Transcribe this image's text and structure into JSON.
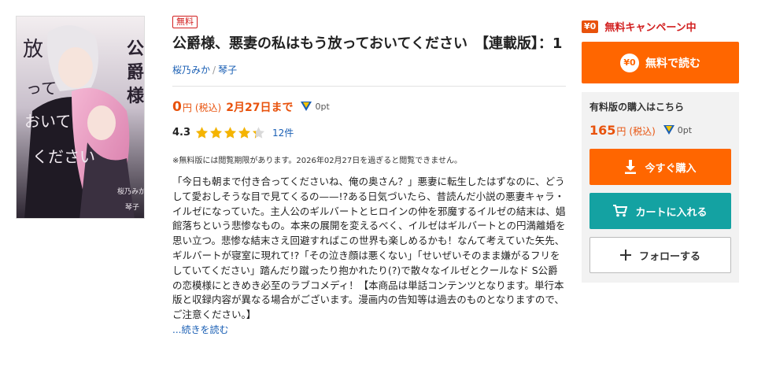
{
  "book": {
    "cover_alt": "公爵様、悪妻の私はもう放っておいてください 表紙",
    "free_badge": "無料",
    "title": "公爵様、悪妻の私はもう放っておいてください　【連載版】：1",
    "authors": [
      "桜乃みか",
      "琴子"
    ],
    "author_separator": "/",
    "price": {
      "amount": "0",
      "unit": "円",
      "tax": "(税込)",
      "deadline": "2月27日まで",
      "points": "0pt"
    },
    "rating": {
      "score": "4.3",
      "stars_value": 4.3,
      "stars_max": 5,
      "review_count": "12件"
    },
    "notice": "※無料版には閲覧期限があります。2026年02月27日を過ぎると閲覧できません。",
    "synopsis": "「今日も朝まで付き合ってくださいね、俺の奥さん？」悪妻に転生したはずなのに、どうして愛おしそうな目で見てくるの——!?ある日気づいたら、昔読んだ小説の悪妻キャラ・イルゼになっていた。主人公のギルバートとヒロインの仲を邪魔するイルゼの結末は、娼館落ちという悲惨なもの。本来の展開を変えるべく、イルゼはギルバートとの円満離婚を思い立つ。悲惨な結末さえ回避すればこの世界も楽しめるかも！なんて考えていた矢先、ギルバートが寝室に現れて!?「その泣き顔は悪くない」「せいぜいそのまま嫌がるフリをしていてください」踏んだり蹴ったり抱かれたり(?)で散々なイルゼとクールなド S公爵の恋模様にときめき必至のラブコメディ！【本商品は単話コンテンツとなります。単行本版と収録内容が異なる場合がございます。漫画内の告知等は過去のものとなりますので、ご注意ください。】",
    "read_more": "...続きを読む"
  },
  "sidebar": {
    "campaign_badge": "¥0",
    "campaign_text": "無料キャンペーン中",
    "free_read_icon": "¥0",
    "free_read_label": "無料で読む",
    "paid_label": "有料版の購入はこちら",
    "paid_price": "165",
    "paid_unit": "円",
    "paid_tax": "(税込)",
    "paid_points": "0pt",
    "buy_now_label": "今すぐ購入",
    "cart_label": "カートに入れる",
    "follow_label": "フォローする"
  },
  "colors": {
    "accent_orange": "#ff6600",
    "price_orange": "#e8520c",
    "campaign_red": "#d21f1f",
    "link_blue": "#1a5fb4",
    "cart_teal": "#14a2a2",
    "star_gold": "#f5b400"
  },
  "icons": {
    "points": "t-point-icon",
    "buy": "download-arrow-icon",
    "cart": "cart-icon",
    "follow": "plus-icon"
  }
}
